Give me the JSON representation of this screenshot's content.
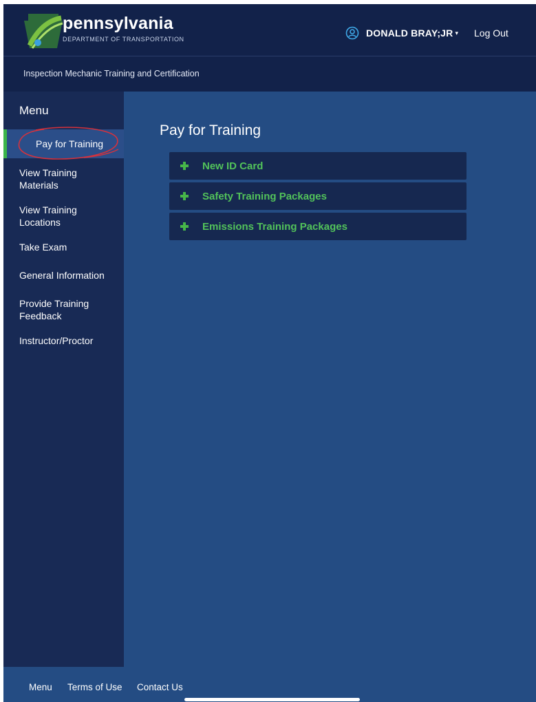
{
  "header": {
    "brand_name": "pennsylvania",
    "brand_subtitle": "DEPARTMENT OF TRANSPORTATION",
    "user_name": "DONALD BRAY;JR",
    "user_caret": "▾",
    "logout_label": "Log Out"
  },
  "subheader": {
    "title": "Inspection Mechanic Training and Certification"
  },
  "sidebar": {
    "heading": "Menu",
    "items": [
      {
        "label": "Pay for Training",
        "active": true
      },
      {
        "label": "View Training Materials"
      },
      {
        "label": "View Training Locations"
      },
      {
        "label": "Take Exam"
      },
      {
        "label": "General Information"
      },
      {
        "label": "Provide Training Feedback"
      },
      {
        "label": "Instructor/Proctor"
      }
    ]
  },
  "main": {
    "title": "Pay for Training",
    "accordion": [
      {
        "label": "New ID Card"
      },
      {
        "label": "Safety Training Packages"
      },
      {
        "label": "Emissions Training Packages"
      }
    ]
  },
  "footer": {
    "links": [
      "Menu",
      "Terms of Use",
      "Contact Us"
    ]
  },
  "colors": {
    "header_bg": "#12224a",
    "sidebar_bg": "#182a55",
    "content_bg": "#244c83",
    "accent_green": "#52c25a",
    "annotation_red": "#d6323c"
  },
  "icons": [
    "pa-keystone-logo",
    "user-circle-icon",
    "plus-icon"
  ]
}
